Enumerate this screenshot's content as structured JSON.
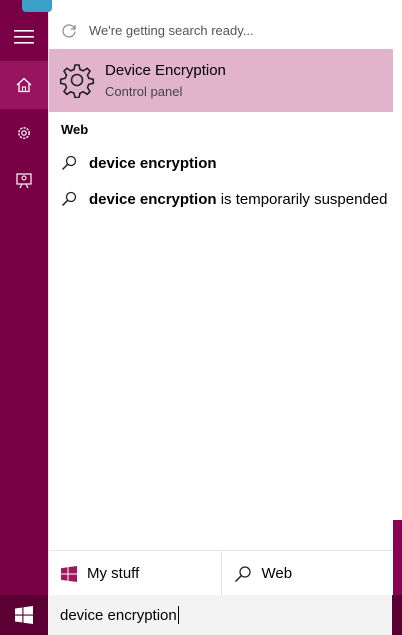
{
  "colors": {
    "rail": "#7a0046",
    "rail_active": "#96155e",
    "taskbar": "#5b0033",
    "best_match_bg": "#e2b4cc"
  },
  "rail": {
    "items": [
      {
        "icon": "hamburger-menu-icon"
      },
      {
        "icon": "home-icon"
      },
      {
        "icon": "gear-icon"
      },
      {
        "icon": "feedback-icon"
      }
    ]
  },
  "status": {
    "icon": "refresh-icon",
    "text": "We're getting search ready..."
  },
  "best_match": {
    "icon": "gear-icon",
    "title": "Device Encryption",
    "subtitle": "Control panel"
  },
  "web_section": {
    "label": "Web",
    "results": [
      {
        "bold": "device encryption",
        "rest": ""
      },
      {
        "bold": "device encryption",
        "rest": " is temporarily suspended"
      }
    ]
  },
  "scopes": {
    "my_stuff": {
      "label": "My stuff",
      "icon": "windows-icon"
    },
    "web": {
      "label": "Web",
      "icon": "search-icon"
    }
  },
  "taskbar": {
    "start_icon": "windows-start-icon",
    "search_value": "device encryption"
  }
}
